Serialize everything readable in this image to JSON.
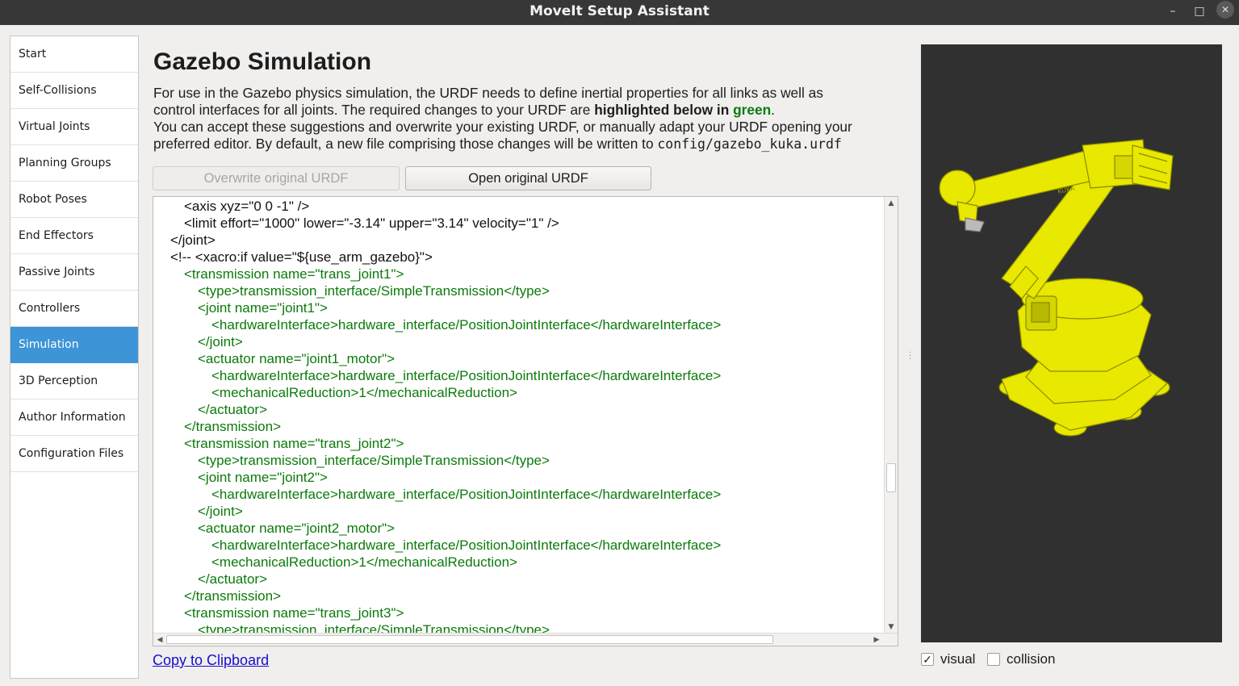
{
  "window": {
    "title": "MoveIt Setup Assistant",
    "minimize": "–",
    "maximize": "□",
    "close": "✕"
  },
  "sidebar": {
    "items": [
      {
        "label": "Start",
        "active": false
      },
      {
        "label": "Self-Collisions",
        "active": false
      },
      {
        "label": "Virtual Joints",
        "active": false
      },
      {
        "label": "Planning Groups",
        "active": false
      },
      {
        "label": "Robot Poses",
        "active": false
      },
      {
        "label": "End Effectors",
        "active": false
      },
      {
        "label": "Passive Joints",
        "active": false
      },
      {
        "label": "Controllers",
        "active": false
      },
      {
        "label": "Simulation",
        "active": true
      },
      {
        "label": "3D Perception",
        "active": false
      },
      {
        "label": "Author Information",
        "active": false
      },
      {
        "label": "Configuration Files",
        "active": false
      }
    ]
  },
  "main": {
    "title": "Gazebo Simulation",
    "description": {
      "line1": "For use in the Gazebo physics simulation, the URDF needs to define inertial properties for all links as well as",
      "line2_pre": "control interfaces for all joints. The required changes to your URDF are ",
      "line2_bold": "highlighted below in ",
      "line2_green": "green",
      "line2_post": ".",
      "line3": "You can accept these suggestions and overwrite your existing URDF, or manually adapt your URDF opening your",
      "line4_pre": "preferred editor. By default, a new file comprising those changes will be written to ",
      "line4_path": "config/gazebo_kuka.urdf"
    },
    "buttons": {
      "overwrite": "Overwrite original URDF",
      "open": "Open original URDF"
    },
    "copy_link": "Copy to Clipboard"
  },
  "code": {
    "lines": [
      {
        "text": "<axis xyz=\"0 0 -1\" />",
        "indent": 2,
        "green": false
      },
      {
        "text": "<limit effort=\"1000\" lower=\"-3.14\" upper=\"3.14\" velocity=\"1\" />",
        "indent": 2,
        "green": false
      },
      {
        "text": "</joint>",
        "indent": 1,
        "green": false
      },
      {
        "text": "<!-- <xacro:if value=\"${use_arm_gazebo}\">",
        "indent": 1,
        "green": false
      },
      {
        "text": "<transmission name=\"trans_joint1\">",
        "indent": 2,
        "green": true
      },
      {
        "text": "<type>transmission_interface/SimpleTransmission</type>",
        "indent": 3,
        "green": true
      },
      {
        "text": "<joint name=\"joint1\">",
        "indent": 3,
        "green": true
      },
      {
        "text": "<hardwareInterface>hardware_interface/PositionJointInterface</hardwareInterface>",
        "indent": 4,
        "green": true
      },
      {
        "text": "</joint>",
        "indent": 3,
        "green": true
      },
      {
        "text": "<actuator name=\"joint1_motor\">",
        "indent": 3,
        "green": true
      },
      {
        "text": "<hardwareInterface>hardware_interface/PositionJointInterface</hardwareInterface>",
        "indent": 4,
        "green": true
      },
      {
        "text": "<mechanicalReduction>1</mechanicalReduction>",
        "indent": 4,
        "green": true
      },
      {
        "text": "</actuator>",
        "indent": 3,
        "green": true
      },
      {
        "text": "</transmission>",
        "indent": 2,
        "green": true
      },
      {
        "text": "<transmission name=\"trans_joint2\">",
        "indent": 2,
        "green": true
      },
      {
        "text": "<type>transmission_interface/SimpleTransmission</type>",
        "indent": 3,
        "green": true
      },
      {
        "text": "<joint name=\"joint2\">",
        "indent": 3,
        "green": true
      },
      {
        "text": "<hardwareInterface>hardware_interface/PositionJointInterface</hardwareInterface>",
        "indent": 4,
        "green": true
      },
      {
        "text": "</joint>",
        "indent": 3,
        "green": true
      },
      {
        "text": "<actuator name=\"joint2_motor\">",
        "indent": 3,
        "green": true
      },
      {
        "text": "<hardwareInterface>hardware_interface/PositionJointInterface</hardwareInterface>",
        "indent": 4,
        "green": true
      },
      {
        "text": "<mechanicalReduction>1</mechanicalReduction>",
        "indent": 4,
        "green": true
      },
      {
        "text": "</actuator>",
        "indent": 3,
        "green": true
      },
      {
        "text": "</transmission>",
        "indent": 2,
        "green": true
      },
      {
        "text": "<transmission name=\"trans_joint3\">",
        "indent": 2,
        "green": true
      },
      {
        "text": "<type>transmission_interface/SimpleTransmission</type>",
        "indent": 3,
        "green": true
      }
    ]
  },
  "viewer": {
    "visual_label": "visual",
    "visual_checked": true,
    "collision_label": "collision",
    "collision_checked": false,
    "robot_brand": "KUKA",
    "robot_color": "#e8e800",
    "background_color": "#303030"
  },
  "icons": {
    "check": "✓",
    "arrow_up": "▲",
    "arrow_down": "▼",
    "arrow_left": "◀",
    "arrow_right": "▶"
  }
}
